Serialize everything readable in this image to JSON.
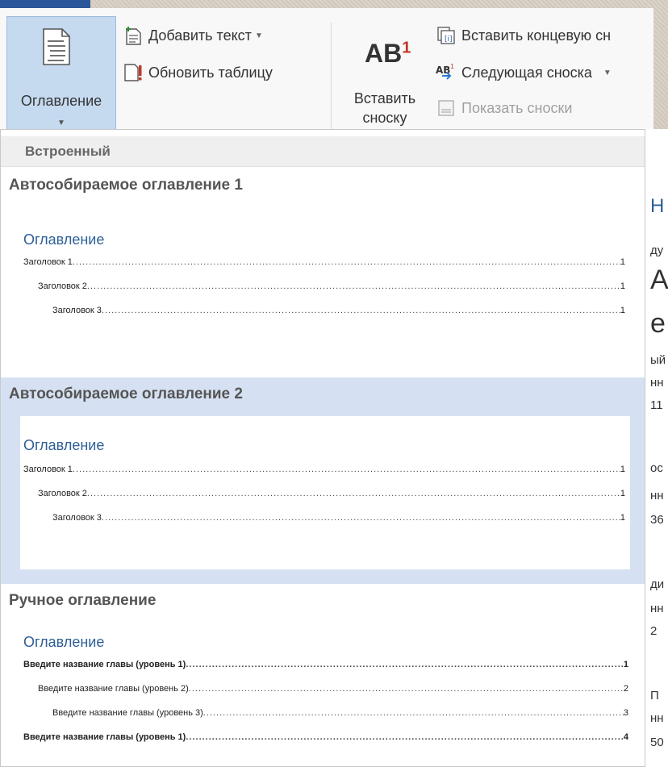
{
  "ribbon": {
    "toc_button_label": "Оглавление",
    "add_text_label": "Добавить текст",
    "update_table_label": "Обновить таблицу",
    "insert_footnote_icon_text": "AB",
    "insert_footnote_icon_sup": "1",
    "insert_footnote_label_line1": "Вставить",
    "insert_footnote_label_line2": "сноску",
    "insert_endnote_label": "Вставить концевую сн",
    "next_footnote_label": "Следующая сноска",
    "show_notes_label": "Показать сноски"
  },
  "gallery": {
    "section_header": "Встроенный",
    "items": [
      {
        "title": "Автособираемое оглавление 1",
        "preview_title": "Оглавление",
        "entries": [
          {
            "text": "Заголовок 1",
            "page": "1"
          },
          {
            "text": "Заголовок 2",
            "page": "1"
          },
          {
            "text": "Заголовок 3",
            "page": "1"
          }
        ]
      },
      {
        "title": "Автособираемое оглавление 2",
        "preview_title": "Оглавление",
        "entries": [
          {
            "text": "Заголовок 1",
            "page": "1"
          },
          {
            "text": "Заголовок 2",
            "page": "1"
          },
          {
            "text": "Заголовок 3",
            "page": "1"
          }
        ]
      },
      {
        "title": "Ручное оглавление",
        "preview_title": "Оглавление",
        "entries": [
          {
            "text": "Введите название главы (уровень 1)",
            "page": "1"
          },
          {
            "text": "Введите название главы (уровень 2)",
            "page": "2"
          },
          {
            "text": "Введите название главы (уровень 3)",
            "page": "3"
          },
          {
            "text": "Введите название главы (уровень 1)",
            "page": "4"
          }
        ]
      }
    ]
  },
  "document_fragments": [
    "Н",
    "ду",
    "А",
    "е",
    "ый",
    "нн",
    "11",
    "ос",
    "нн",
    "36",
    "ди",
    "нн",
    "2",
    "П",
    "нн",
    "50"
  ],
  "colors": {
    "accent": "#2b579a",
    "toc_button_bg": "#c5d9ef",
    "selected_item_bg": "#d5e1f2",
    "preview_heading": "#2e5f97",
    "update_icon_red": "#c0392b"
  },
  "icons": {
    "toc": "document-lines-icon",
    "add_text": "add-text-icon",
    "update_table": "update-table-icon",
    "insert_endnote": "insert-endnote-icon",
    "next_footnote": "next-footnote-icon",
    "show_notes": "show-notes-icon"
  }
}
